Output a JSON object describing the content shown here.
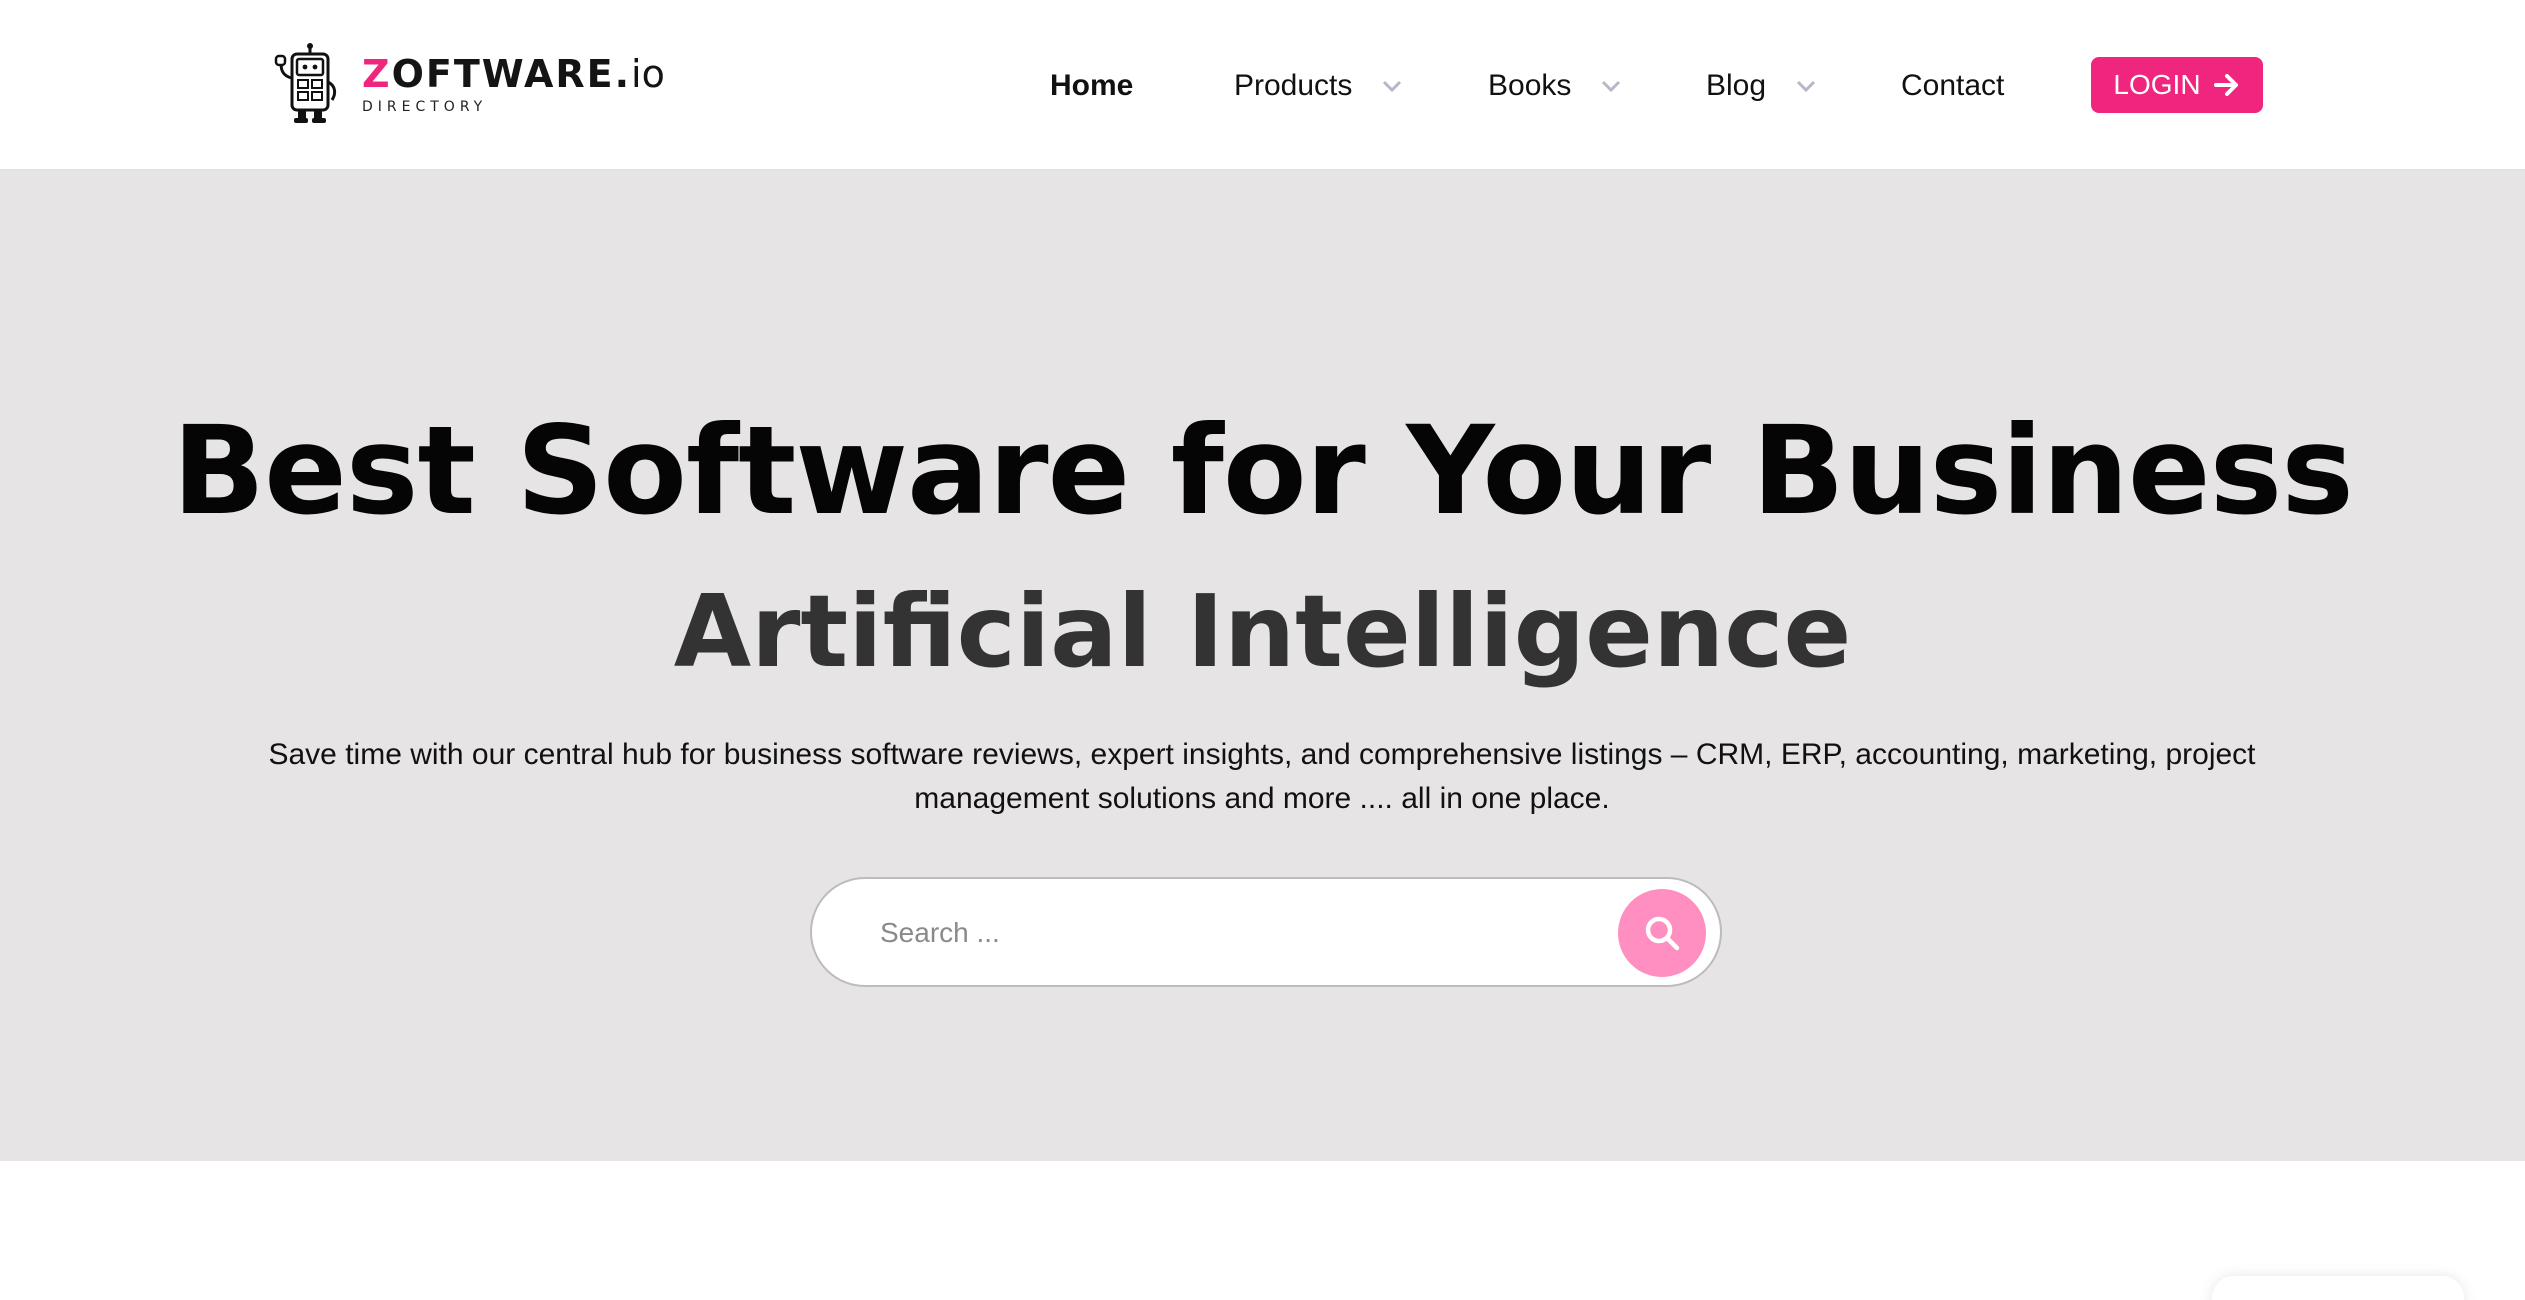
{
  "brand": {
    "letter_z": "Z",
    "name_rest": "OFTWARE.",
    "tld": "io",
    "tagline": "DIRECTORY",
    "accent_color": "#f0257e"
  },
  "nav": {
    "items": [
      {
        "label": "Home",
        "active": true,
        "dropdown": false
      },
      {
        "label": "Products",
        "active": false,
        "dropdown": true
      },
      {
        "label": "Books",
        "active": false,
        "dropdown": true
      },
      {
        "label": "Blog",
        "active": false,
        "dropdown": true
      },
      {
        "label": "Contact",
        "active": false,
        "dropdown": false
      }
    ],
    "login_label": "LOGIN",
    "login_icon": "arrow-right-icon"
  },
  "hero": {
    "title": "Best Software for Your Business",
    "subtitle": "Artificial Intelligence",
    "description": "Save time with our central hub for business software reviews, expert insights, and comprehensive listings – CRM, ERP, accounting, marketing, project management solutions and more .... all in one place.",
    "background_color": "#e6e4e5"
  },
  "search": {
    "placeholder": "Search ...",
    "value": "",
    "icon": "search-icon",
    "button_color": "#ff8fc0"
  }
}
